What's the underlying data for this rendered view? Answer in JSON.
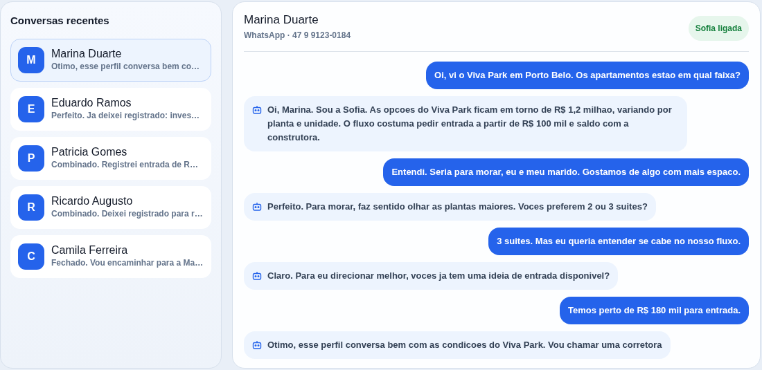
{
  "sidebar": {
    "title": "Conversas recentes",
    "items": [
      {
        "initial": "M",
        "name": "Marina Duarte",
        "preview": "Otimo, esse perfil conversa bem co…",
        "selected": true
      },
      {
        "initial": "E",
        "name": "Eduardo Ramos",
        "preview": "Perfeito. Ja deixei registrado: inves…",
        "selected": false
      },
      {
        "initial": "P",
        "name": "Patricia Gomes",
        "preview": "Combinado. Registrei entrada de R…",
        "selected": false
      },
      {
        "initial": "R",
        "name": "Ricardo Augusto",
        "preview": "Combinado. Deixei registrado para r…",
        "selected": false
      },
      {
        "initial": "C",
        "name": "Camila Ferreira",
        "preview": "Fechado. Vou encaminhar para a Ma…",
        "selected": false
      }
    ]
  },
  "chat": {
    "name": "Marina Duarte",
    "subtitle": "WhatsApp · 47 9 9123-0184",
    "badge": "Sofia ligada",
    "messages": [
      {
        "kind": "user",
        "text": "Oi, vi o Viva Park em Porto Belo. Os apartamentos estao em qual faixa?"
      },
      {
        "kind": "bot",
        "text": "Oi, Marina. Sou a Sofia. As opcoes do Viva Park ficam em torno de R$ 1,2 milhao, variando por planta e unidade. O fluxo costuma pedir entrada a partir de R$ 100 mil e saldo com a construtora."
      },
      {
        "kind": "user",
        "text": "Entendi. Seria para morar, eu e meu marido. Gostamos de algo com mais espaco."
      },
      {
        "kind": "bot",
        "text": "Perfeito. Para morar, faz sentido olhar as plantas maiores. Voces preferem 2 ou 3 suites?"
      },
      {
        "kind": "user",
        "text": "3 suites. Mas eu queria entender se cabe no nosso fluxo."
      },
      {
        "kind": "bot",
        "text": "Claro. Para eu direcionar melhor, voces ja tem uma ideia de entrada disponivel?"
      },
      {
        "kind": "user",
        "text": "Temos perto de R$ 180 mil para entrada."
      },
      {
        "kind": "bot",
        "text": "Otimo, esse perfil conversa bem com as condicoes do Viva Park. Vou chamar uma corretora"
      }
    ]
  }
}
